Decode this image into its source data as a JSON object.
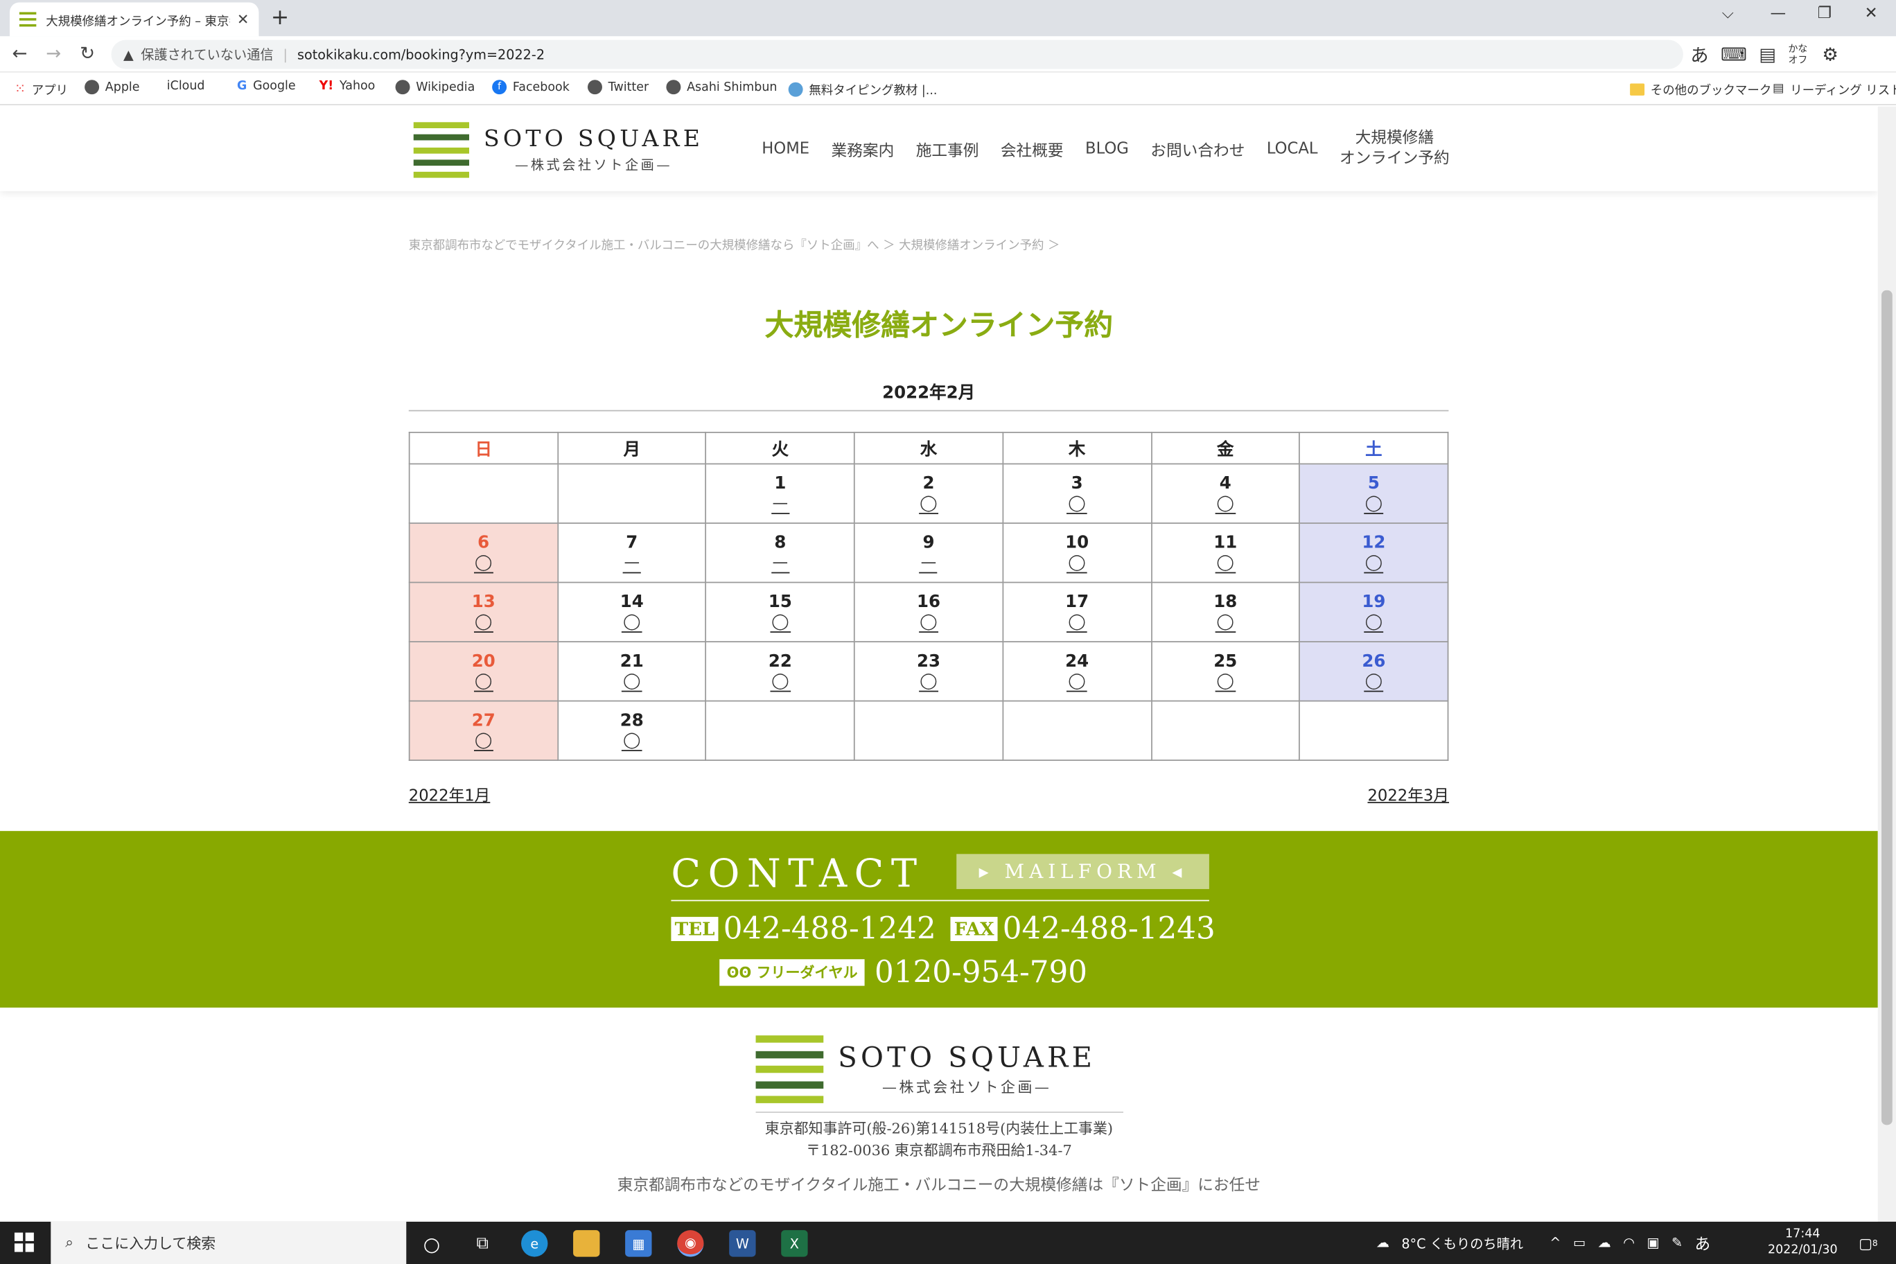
{
  "browser": {
    "tab_title": "大規模修繕オンライン予約 – 東京都",
    "tab_close": "✕",
    "new_tab": "+",
    "insecure_label": "保護されていない通信",
    "url": "sotokikaku.com/booking?ym=2022-2",
    "ime_kana": "あ",
    "ime_kana_off": "かな オフ",
    "bookmarks": [
      {
        "label": "アプリ"
      },
      {
        "label": "Apple"
      },
      {
        "label": "iCloud"
      },
      {
        "label": "Google"
      },
      {
        "label": "Yahoo"
      },
      {
        "label": "Wikipedia"
      },
      {
        "label": "Facebook"
      },
      {
        "label": "Twitter"
      },
      {
        "label": "Asahi Shimbun"
      },
      {
        "label": "無料タイピング教材 |..."
      }
    ],
    "other_bookmarks": "その他のブックマーク",
    "reading_list": "リーディング リスト"
  },
  "site": {
    "logo_en": "SOTO SQUARE",
    "logo_jp": "—株式会社ソト企画—",
    "logo_colors": [
      "#a8c62a",
      "#3f6b2f",
      "#a8c62a",
      "#3f6b2f",
      "#a8c62a"
    ],
    "nav": {
      "home": "HOME",
      "services": "業務案内",
      "cases": "施工事例",
      "company": "会社概要",
      "blog": "BLOG",
      "contact": "お問い合わせ",
      "local": "LOCAL",
      "booking_line1": "大規模修繕",
      "booking_line2": "オンライン予約"
    },
    "breadcrumb": "東京都調布市などでモザイクタイル施工・バルコニーの大規模修繕なら『ソト企画』へ ＞ 大規模修繕オンライン予約 ＞",
    "page_title": "大規模修繕オンライン予約",
    "accent_color": "#8aac12"
  },
  "calendar": {
    "month_title": "2022年2月",
    "weekdays": {
      "sun": "日",
      "mon": "月",
      "tue": "火",
      "wed": "水",
      "thu": "木",
      "fri": "金",
      "sat": "土"
    },
    "weeks": [
      [
        {
          "d": "",
          "m": ""
        },
        {
          "d": "",
          "m": ""
        },
        {
          "d": "1",
          "m": "—"
        },
        {
          "d": "2",
          "m": "◯"
        },
        {
          "d": "3",
          "m": "◯"
        },
        {
          "d": "4",
          "m": "◯"
        },
        {
          "d": "5",
          "m": "◯"
        }
      ],
      [
        {
          "d": "6",
          "m": "◯"
        },
        {
          "d": "7",
          "m": "—"
        },
        {
          "d": "8",
          "m": "—"
        },
        {
          "d": "9",
          "m": "—"
        },
        {
          "d": "10",
          "m": "◯"
        },
        {
          "d": "11",
          "m": "◯"
        },
        {
          "d": "12",
          "m": "◯"
        }
      ],
      [
        {
          "d": "13",
          "m": "◯"
        },
        {
          "d": "14",
          "m": "◯"
        },
        {
          "d": "15",
          "m": "◯"
        },
        {
          "d": "16",
          "m": "◯"
        },
        {
          "d": "17",
          "m": "◯"
        },
        {
          "d": "18",
          "m": "◯"
        },
        {
          "d": "19",
          "m": "◯"
        }
      ],
      [
        {
          "d": "20",
          "m": "◯"
        },
        {
          "d": "21",
          "m": "◯"
        },
        {
          "d": "22",
          "m": "◯"
        },
        {
          "d": "23",
          "m": "◯"
        },
        {
          "d": "24",
          "m": "◯"
        },
        {
          "d": "25",
          "m": "◯"
        },
        {
          "d": "26",
          "m": "◯"
        }
      ],
      [
        {
          "d": "27",
          "m": "◯"
        },
        {
          "d": "28",
          "m": "◯"
        },
        {
          "d": "",
          "m": ""
        },
        {
          "d": "",
          "m": ""
        },
        {
          "d": "",
          "m": ""
        },
        {
          "d": "",
          "m": ""
        },
        {
          "d": "",
          "m": ""
        }
      ]
    ],
    "prev_month": "2022年1月",
    "next_month": "2022年3月",
    "sun_color": "#e85a3a",
    "sat_color": "#3a5bd0"
  },
  "contact": {
    "heading": "CONTACT",
    "mailform": "▸ MAILFORM ◂",
    "tel_label": "TEL",
    "tel": "042-488-1242",
    "fax_label": "FAX",
    "fax": "042-488-1243",
    "free_label": "ʘʘ フリーダイヤル",
    "free": "0120-954-790",
    "bg_color": "#88a900"
  },
  "footer": {
    "logo_en": "SOTO SQUARE",
    "logo_jp": "—株式会社ソト企画—",
    "license": "東京都知事許可(般-26)第141518号(内装仕上工事業)",
    "address": "〒182-0036 東京都調布市飛田給1-34-7",
    "tagline": "東京都調布市などのモザイクタイル施工・バルコニーの大規模修繕は『ソト企画』にお任せ"
  },
  "taskbar": {
    "search_placeholder": "ここに入力して検索",
    "weather": "8°C くもりのち晴れ",
    "ime": "あ",
    "time": "17:44",
    "date": "2022/01/30",
    "notification_count": "8"
  }
}
